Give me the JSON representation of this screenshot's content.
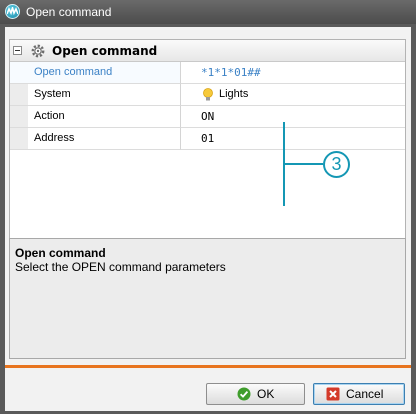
{
  "window": {
    "title": "Open command"
  },
  "properties": {
    "group_title": "Open command",
    "rows": [
      {
        "name": "Open command",
        "value": "*1*1*01##"
      },
      {
        "name": "System",
        "value": "Lights",
        "icon": "lightbulb-icon"
      },
      {
        "name": "Action",
        "value": "ON"
      },
      {
        "name": "Address",
        "value": "01"
      }
    ]
  },
  "callout": {
    "number": "3"
  },
  "description": {
    "title": "Open command",
    "text": "Select the OPEN command parameters"
  },
  "buttons": {
    "ok_label": "OK",
    "cancel_label": "Cancel"
  },
  "colors": {
    "accent": "#e8751f",
    "callout": "#1497b4",
    "selected_text": "#3c82c6"
  }
}
